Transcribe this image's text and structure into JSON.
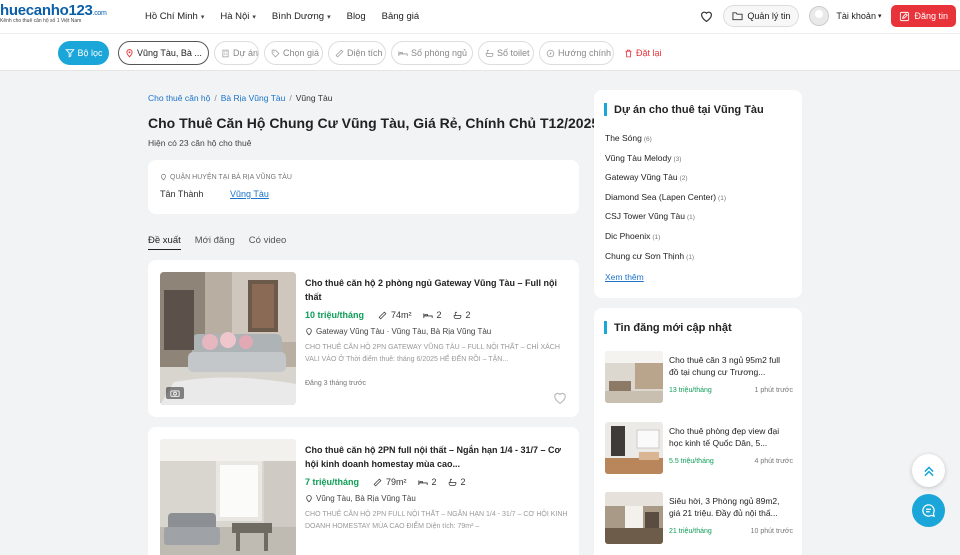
{
  "header": {
    "logo_main": "huecanho123",
    "logo_suffix": ".com",
    "logo_sub": "Kênh cho thuê căn hộ số 1 Việt Nam",
    "nav": [
      {
        "label": "Hồ Chí Minh",
        "dropdown": true
      },
      {
        "label": "Hà Nội",
        "dropdown": true
      },
      {
        "label": "Bình Dương",
        "dropdown": true
      },
      {
        "label": "Blog",
        "dropdown": false
      },
      {
        "label": "Bảng giá",
        "dropdown": false
      }
    ],
    "manage_label": "Quản lý tin",
    "account_label": "Tài khoản",
    "post_label": "Đăng tin"
  },
  "filters": {
    "main_label": "Bộ lọc",
    "location_label": "Vũng Tàu, Bà ...",
    "project_label": "Dự án",
    "price_label": "Chọn giá",
    "area_label": "Diện tích",
    "bedrooms_label": "Số phòng ngủ",
    "toilets_label": "Số toilet",
    "direction_label": "Hướng chính",
    "reset_label": "Đặt lại"
  },
  "breadcrumb": [
    "Cho thuê căn hộ",
    "Bà Rịa Vũng Tàu",
    "Vũng Tàu"
  ],
  "page_title": "Cho Thuê Căn Hộ Chung Cư Vũng Tàu, Giá Rẻ, Chính Chủ T12/2025",
  "subtitle": "Hiện có 23 căn hộ cho thuê",
  "districts": {
    "heading": "QUẬN HUYỆN TẠI BÀ RỊA VŨNG TÀU",
    "items": [
      "Tân Thành",
      "Vũng Tàu"
    ]
  },
  "tabs": [
    "Đề xuất",
    "Mới đăng",
    "Có video"
  ],
  "listings": [
    {
      "title": "Cho thuê căn hộ 2 phòng ngủ Gateway Vũng Tàu – Full nội thất",
      "price": "10 triệu/tháng",
      "area": "74m²",
      "bedrooms": "2",
      "bathrooms": "2",
      "address": "Gateway Vũng Tàu · Vũng Tàu, Bà Rịa Vũng Tàu",
      "description": "CHO THUÊ CĂN HỘ 2PN GATEWAY VŨNG TÀU – FULL NỘI THẤT – CHỈ XÁCH VALI VÀO Ở Thời điểm thuê: tháng 6/2025 HẾ ĐẾN RỒI – TẬN...",
      "time": "Đăng 3 tháng trước"
    },
    {
      "title": "Cho thuê căn hộ 2PN full nội thất – Ngắn hạn 1/4 - 31/7 – Cơ hội kinh doanh homestay mùa cao...",
      "price": "7 triệu/tháng",
      "area": "79m²",
      "bedrooms": "2",
      "bathrooms": "2",
      "address": "Vũng Tàu, Bà Rịa Vũng Tàu",
      "description": "CHO THUÊ CĂN HỘ 2PN FULL NỘI THẤT – NGẮN HẠN 1/4 - 31/7 – CƠ HỘI KINH DOANH HOMESTAY MÙA CAO ĐIỂM Diện tích: 79m² –",
      "time": ""
    }
  ],
  "projects": {
    "title": "Dự án cho thuê tại Vũng Tàu",
    "items": [
      {
        "name": "The Sóng",
        "count": "(6)"
      },
      {
        "name": "Vũng Tàu Melody",
        "count": "(3)"
      },
      {
        "name": "Gateway Vũng Tàu",
        "count": "(2)"
      },
      {
        "name": "Diamond Sea (Lapen Center)",
        "count": "(1)"
      },
      {
        "name": "CSJ Tower Vũng Tàu",
        "count": "(1)"
      },
      {
        "name": "Dic Phoenix",
        "count": "(1)"
      },
      {
        "name": "Chung cư Sơn Thịnh",
        "count": "(1)"
      }
    ],
    "see_more": "Xem thêm"
  },
  "news": {
    "title": "Tin đăng mới cập nhật",
    "items": [
      {
        "title": "Cho thuê căn 3 ngủ 95m2 full đồ tại chung cư Trương...",
        "price": "13 triệu/tháng",
        "time": "1 phút trước"
      },
      {
        "title": "Cho thuê phòng đẹp view đại học kinh tế Quốc Dân, 5...",
        "price": "5.5 triệu/tháng",
        "time": "4 phút trước"
      },
      {
        "title": "Siêu hời, 3 Phòng ngủ 89m2, giá 21 triệu. Đầy đủ nội thấ...",
        "price": "21 triệu/tháng",
        "time": "10 phút trước"
      }
    ]
  },
  "colors": {
    "accent": "#1aa6d8",
    "danger": "#e8333a",
    "price": "#0f9d58",
    "link": "#1a73c8"
  }
}
